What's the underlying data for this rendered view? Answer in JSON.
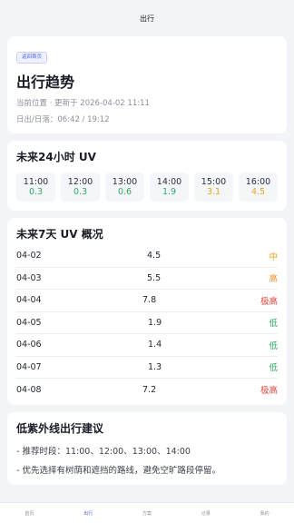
{
  "navbar": {
    "title": "出行"
  },
  "header": {
    "back_label": "返回首页",
    "title": "出行趋势",
    "location_line": "当前位置 · 更新于 2026-04-02 11:11",
    "sun_line": "日出/日落：06:42 / 19:12"
  },
  "hourly": {
    "title": "未来24小时 UV",
    "items": [
      {
        "time": "11:00",
        "value": "0.3",
        "color": "#2eaa5c"
      },
      {
        "time": "12:00",
        "value": "0.3",
        "color": "#2eaa5c"
      },
      {
        "time": "13:00",
        "value": "0.6",
        "color": "#2eaa5c"
      },
      {
        "time": "14:00",
        "value": "1.9",
        "color": "#2eaa5c"
      },
      {
        "time": "15:00",
        "value": "3.1",
        "color": "#e9a21f"
      },
      {
        "time": "16:00",
        "value": "4.5",
        "color": "#e9a21f"
      }
    ]
  },
  "daily": {
    "title": "未来7天 UV 概况",
    "rows": [
      {
        "date": "04-02",
        "value": "4.5",
        "level": "中",
        "color": "#e9a21f"
      },
      {
        "date": "04-03",
        "value": "5.5",
        "level": "高",
        "color": "#f08a1c"
      },
      {
        "date": "04-04",
        "value": "7.8",
        "level": "极高",
        "color": "#e0413a"
      },
      {
        "date": "04-05",
        "value": "1.9",
        "level": "低",
        "color": "#2eaa5c"
      },
      {
        "date": "04-06",
        "value": "1.4",
        "level": "低",
        "color": "#2eaa5c"
      },
      {
        "date": "04-07",
        "value": "1.3",
        "level": "低",
        "color": "#2eaa5c"
      },
      {
        "date": "04-08",
        "value": "7.2",
        "level": "极高",
        "color": "#e0413a"
      }
    ]
  },
  "advice": {
    "title": "低紫外线出行建议",
    "lines": [
      "- 推荐时段：11:00、12:00、13:00、14:00",
      "- 优先选择有树荫和遮挡的路线，避免空旷路段停留。"
    ]
  },
  "tabbar": {
    "items": [
      {
        "label": "首页",
        "active": false
      },
      {
        "label": "出行",
        "active": true
      },
      {
        "label": "方案",
        "active": false
      },
      {
        "label": "记录",
        "active": false
      },
      {
        "label": "我的",
        "active": false
      }
    ]
  }
}
